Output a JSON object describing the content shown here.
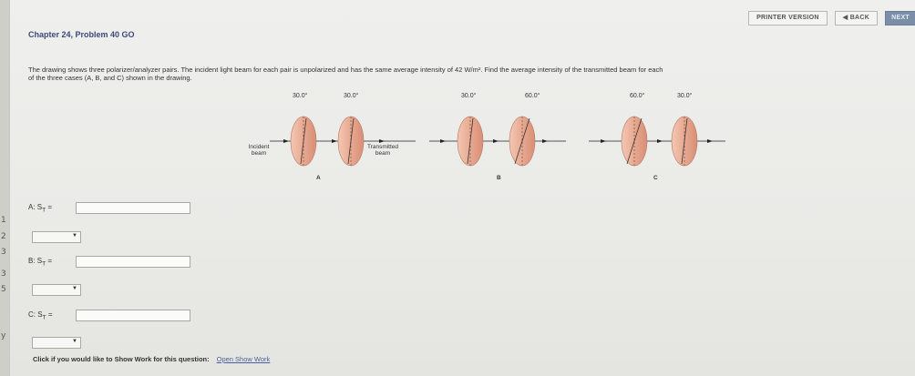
{
  "toolbar": {
    "printer_label": "PRINTER VERSION",
    "back_label": "◀ BACK",
    "next_label": "NEXT"
  },
  "header": {
    "title": "Chapter 24, Problem 40 GO"
  },
  "problem": {
    "text_line1": "The drawing shows three polarizer/analyzer pairs. The incident light beam for each pair is unpolarized and has the same average intensity of 42 W/m². Find the average intensity of the transmitted beam for each",
    "text_line2": "of the three cases (A, B, and C) shown in the drawing."
  },
  "figure": {
    "case_a": {
      "angle1": "30.0°",
      "angle2": "30.0°",
      "letter": "A"
    },
    "case_b": {
      "angle1": "30.0°",
      "angle2": "60.0°",
      "letter": "B"
    },
    "case_c": {
      "angle1": "60.0°",
      "angle2": "30.0°",
      "letter": "C"
    },
    "incident_label": "Incident beam",
    "transmitted_label": "Transmitted beam"
  },
  "answers": {
    "a_label": "A: S",
    "b_label": "B: S",
    "c_label": "C: S",
    "subscript": "T",
    "equals": " =",
    "a_value": "",
    "b_value": "",
    "c_value": "",
    "a_unit": "",
    "b_unit": "",
    "c_unit": ""
  },
  "footer": {
    "prompt": "Click if you would like to Show Work for this question:",
    "link": "Open Show Work"
  },
  "colors": {
    "accent": "#3c4a7a",
    "polarizer": "#e8a890",
    "link": "#4a5fa0"
  }
}
